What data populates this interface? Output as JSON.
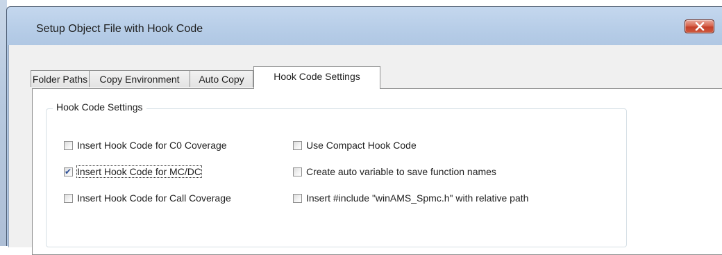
{
  "window": {
    "title": "Setup Object File with Hook Code",
    "close_icon": "close-icon",
    "close_color": "#c4402a"
  },
  "tabs": [
    {
      "label": "Folder Paths",
      "selected": false
    },
    {
      "label": "Copy Environment",
      "selected": false
    },
    {
      "label": "Auto Copy",
      "selected": false
    },
    {
      "label": "Hook Code Settings",
      "selected": true
    }
  ],
  "group": {
    "title": "Hook Code Settings",
    "options": [
      {
        "label": "Insert Hook Code for C0 Coverage",
        "checked": false
      },
      {
        "label": "Insert Hook Code for MC/DC",
        "checked": true,
        "focused": true
      },
      {
        "label": "Insert Hook Code for Call Coverage",
        "checked": false
      },
      {
        "label": "Use Compact Hook Code",
        "checked": false
      },
      {
        "label": "Create auto variable to save function names",
        "checked": false
      },
      {
        "label": "Insert #include \"winAMS_Spmc.h\" with relative path",
        "checked": false
      }
    ]
  },
  "checkmark_glyph": "✔"
}
